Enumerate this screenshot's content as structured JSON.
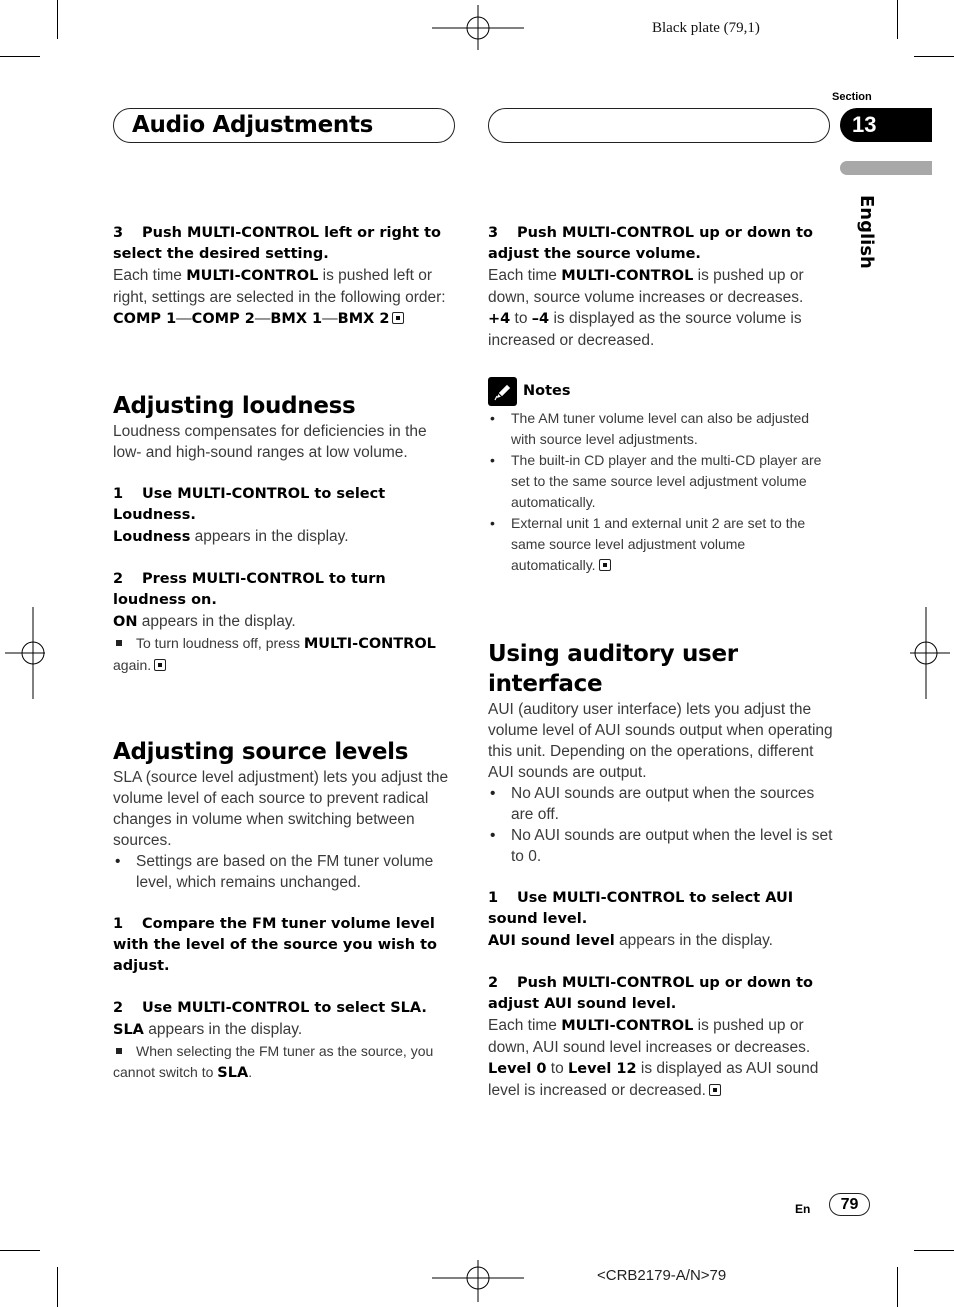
{
  "print_marks": {
    "plate_label": "Black plate (79,1)",
    "job_code": "<CRB2179-A/N>79"
  },
  "header": {
    "title": "Audio Adjustments",
    "section_label": "Section",
    "section_number": "13",
    "language": "English"
  },
  "left_column": {
    "step3": {
      "number": "3",
      "heading": "Push MULTI-CONTROL left or right to select the desired setting.",
      "body_pre": "Each time ",
      "body_bold": "MULTI-CONTROL",
      "body_post": " is pushed left or right, settings are selected in the following order:",
      "order": [
        "COMP 1",
        "COMP 2",
        "BMX 1",
        "BMX 2"
      ],
      "separator": "—"
    },
    "loudness": {
      "title": "Adjusting loudness",
      "intro": "Loudness compensates for deficiencies in the low- and high-sound ranges at low volume.",
      "step1": {
        "number": "1",
        "heading": "Use MULTI-CONTROL to select Loudness.",
        "result_bold": "Loudness",
        "result_text": " appears in the display."
      },
      "step2": {
        "number": "2",
        "heading": "Press MULTI-CONTROL to turn loudness on.",
        "result_bold": "ON",
        "result_text": " appears in the display.",
        "note_pre": "To turn loudness off, press ",
        "note_bold": "MULTI-CONTROL",
        "note_post": " again."
      }
    },
    "source_levels": {
      "title": "Adjusting source levels",
      "intro": "SLA (source level adjustment) lets you adjust the volume level of each source to prevent radical changes in volume when switching between sources.",
      "bullets": [
        "Settings are based on the FM tuner volume level, which remains unchanged."
      ],
      "step1": {
        "number": "1",
        "heading": "Compare the FM tuner volume level with the level of the source you wish to adjust."
      },
      "step2": {
        "number": "2",
        "heading": "Use MULTI-CONTROL to select SLA.",
        "result_bold": "SLA",
        "result_text": " appears in the display.",
        "note_pre": "When selecting the FM tuner as the source, you cannot switch to ",
        "note_bold": "SLA",
        "note_post": "."
      }
    }
  },
  "right_column": {
    "step3": {
      "number": "3",
      "heading": "Push MULTI-CONTROL up or down to adjust the source volume.",
      "body_pre": "Each time ",
      "body_bold": "MULTI-CONTROL",
      "body_post": " is pushed up or down, source volume increases or decreases.",
      "range_from": "+4",
      "range_mid": " to ",
      "range_to": "–4",
      "range_post": " is displayed as the source volume is increased or decreased."
    },
    "notes": {
      "label": "Notes",
      "items": [
        "The AM tuner volume level can also be adjusted with source level adjustments.",
        "The built-in CD player and the multi-CD player are set to the same source level adjustment volume automatically.",
        "External unit 1 and external unit 2 are set to the same source level adjustment volume automatically."
      ]
    },
    "aui": {
      "title": "Using auditory user interface",
      "intro": "AUI (auditory user interface) lets you adjust the volume level of AUI sounds output when operating this unit. Depending on the operations, different AUI sounds are output.",
      "bullets": [
        "No AUI sounds are output when the sources are off.",
        "No AUI sounds are output when the level is set to 0."
      ],
      "step1": {
        "number": "1",
        "heading": "Use MULTI-CONTROL to select AUI sound level.",
        "result_bold": "AUI sound level",
        "result_text": " appears in the display."
      },
      "step2": {
        "number": "2",
        "heading": "Push MULTI-CONTROL up or down to adjust AUI sound level.",
        "body_pre": "Each time ",
        "body_bold": "MULTI-CONTROL",
        "body_post": " is pushed up or down, AUI sound level increases or decreases.",
        "range_from": "Level 0",
        "range_mid": " to ",
        "range_to": "Level 12",
        "range_post": " is displayed as AUI sound level is increased or decreased."
      }
    }
  },
  "footer": {
    "lang_code": "En",
    "page_number": "79"
  }
}
